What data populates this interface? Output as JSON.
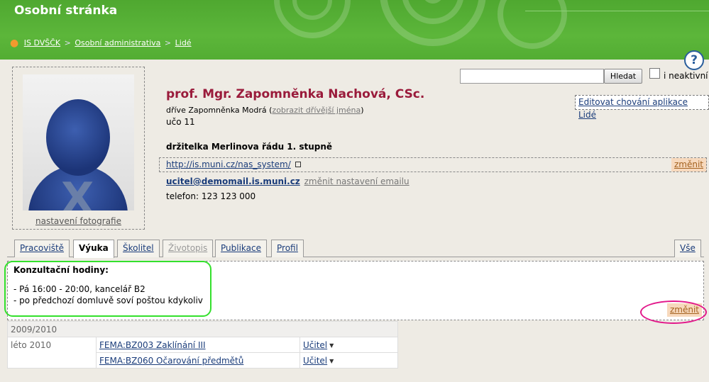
{
  "header": {
    "title": "Osobní stránka",
    "breadcrumbs": [
      "IS DVŠČK",
      "Osobní administrativa",
      "Lidé"
    ],
    "separator": ">"
  },
  "help": {
    "label": "?"
  },
  "search": {
    "button_label": "Hledat",
    "value": "",
    "checkbox_label": "i neaktivní"
  },
  "photo": {
    "link_label": "nastavení fotografie"
  },
  "profile": {
    "name": "prof. Mgr. Zapomněnka Nachová, CSc.",
    "former_prefix": "dříve Zapomněnka Modrá (",
    "former_link": "zobrazit dřívější jména",
    "former_suffix": ")",
    "uco": "učo 11",
    "award": "držitelka Merlinova řádu 1. stupně",
    "url": "http://is.muni.cz/nas_system/",
    "url_edit": "změnit",
    "email": "ucitel@demomail.is.muni.cz",
    "email_settings": "změnit nastavení emailu",
    "phone": "telefon: 123 123 000",
    "edit_app": "Editovat chování aplikace Lidé"
  },
  "tabs": [
    "Pracoviště",
    "Výuka",
    "Školitel",
    "Životopis",
    "Publikace",
    "Profil",
    "Vše"
  ],
  "consult": {
    "title": "Konzultační hodiny:",
    "lines": [
      "- Pá 16:00 - 20:00, kancelář B2",
      "- po předchozí domluvě soví poštou kdykoliv"
    ],
    "edit": "změnit"
  },
  "courses": {
    "year": "2009/2010",
    "term": "léto 2010",
    "rows": [
      {
        "course": "FEMA:BZ003 Zaklínání III",
        "role": "Učitel"
      },
      {
        "course": "FEMA:BZ060 Očarování předmětů",
        "role": "Učitel"
      }
    ]
  },
  "colors": {
    "header_green": "#5cb63a",
    "name_color": "#9a1b3b",
    "highlight_green": "#33e02c",
    "highlight_pink": "#e2178a"
  }
}
